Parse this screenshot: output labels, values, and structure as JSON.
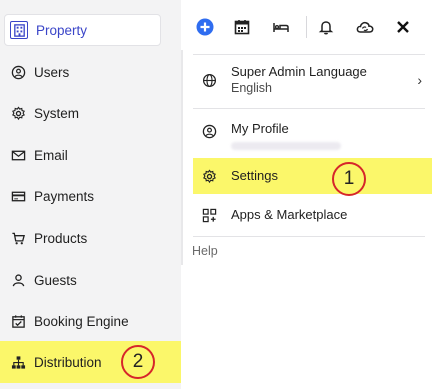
{
  "sidebar": {
    "items": [
      {
        "label": "Property",
        "icon": "property-icon"
      },
      {
        "label": "Users",
        "icon": "user-circle-icon"
      },
      {
        "label": "System",
        "icon": "gear-icon"
      },
      {
        "label": "Email",
        "icon": "envelope-icon"
      },
      {
        "label": "Payments",
        "icon": "credit-card-icon"
      },
      {
        "label": "Products",
        "icon": "cart-icon"
      },
      {
        "label": "Guests",
        "icon": "person-icon"
      },
      {
        "label": "Booking Engine",
        "icon": "calendar-check-icon"
      },
      {
        "label": "Distribution",
        "icon": "sitemap-icon"
      }
    ]
  },
  "toolbar": {
    "icons": [
      "add-icon",
      "calendar-icon",
      "bed-icon",
      "bell-icon",
      "cloud-icon",
      "close-icon"
    ]
  },
  "dropdown": {
    "language": {
      "title": "Super Admin Language",
      "value": "English"
    },
    "profile": {
      "title": "My Profile"
    },
    "settings": {
      "label": "Settings"
    },
    "apps": {
      "label": "Apps & Marketplace"
    },
    "help": "Help"
  },
  "annotations": {
    "one": "1",
    "two": "2"
  },
  "colors": {
    "accent": "#3a45c8",
    "highlight": "#fbf76a",
    "annotation": "#d6262a",
    "add_button": "#2f6df0"
  }
}
